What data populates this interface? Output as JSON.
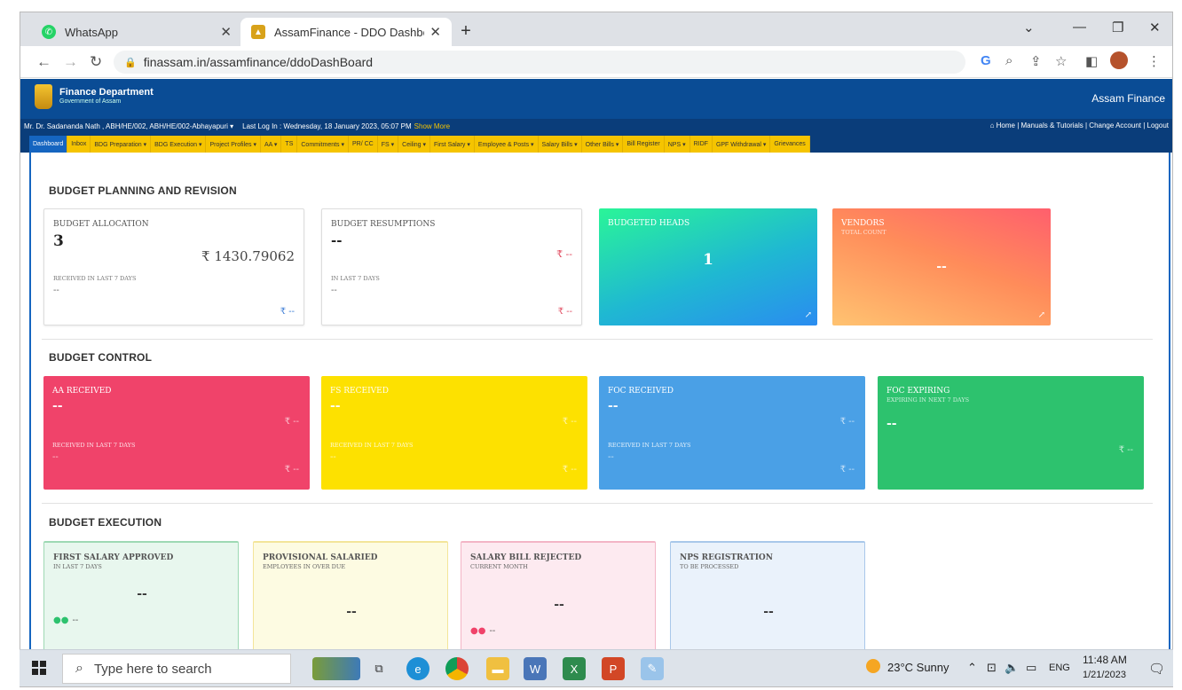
{
  "browser": {
    "tabs": [
      {
        "title": "WhatsApp",
        "active": false
      },
      {
        "title": "AssamFinance - DDO Dashboard",
        "active": true
      }
    ],
    "url": "finassam.in/assamfinance/ddoDashBoard"
  },
  "header": {
    "dept": "Finance Department",
    "govt": "Government of Assam",
    "brand": "Assam Finance",
    "user": "Mr. Dr. Sadananda Nath , ABH/HE/002, ABH/HE/002-Abhayapuri ▾",
    "last_login": "Last Log In : Wednesday, 18 January 2023, 05:07 PM",
    "show_more": "Show More",
    "links": "⌂ Home | Manuals & Tutorials | Change Account | Logout"
  },
  "menu": [
    "Dashboard",
    "Inbox",
    "BDG Preparation ▾",
    "BDG Execution ▾",
    "Project Profiles ▾",
    "AA ▾",
    "TS",
    "Commitments ▾",
    "PR/ CC",
    "FS ▾",
    "Ceiling ▾",
    "First Salary ▾",
    "Employee & Posts ▾",
    "Salary Bills ▾",
    "Other Bills ▾",
    "Bill Register",
    "NPS ▾",
    "RIDF",
    "GPF Withdrawal ▾",
    "Grievances"
  ],
  "sections": {
    "planning": "BUDGET PLANNING AND REVISION",
    "control": "BUDGET CONTROL",
    "execution": "BUDGET EXECUTION"
  },
  "planning_cards": {
    "allocation": {
      "label": "BUDGET ALLOCATION",
      "count": "3",
      "amount": "₹ 1430.79062",
      "recent_label": "RECEIVED IN LAST 7 DAYS",
      "recent_value": "--",
      "recent_amount": "₹ --"
    },
    "resumptions": {
      "label": "BUDGET RESUMPTIONS",
      "count": "--",
      "amount": "₹ --",
      "recent_label": "IN LAST 7 DAYS",
      "recent_value": "--",
      "recent_amount": "₹ --"
    },
    "heads": {
      "label": "BUDGETED HEADS",
      "value": "1"
    },
    "vendors": {
      "label": "VENDORS",
      "sub": "TOTAL COUNT",
      "value": "--"
    }
  },
  "control_cards": [
    {
      "label": "AA RECEIVED",
      "value": "--",
      "amount": "₹ --",
      "recent_label": "RECEIVED IN LAST 7 DAYS",
      "recent_value": "--",
      "recent_amount": "₹ --",
      "color": "#f0436a"
    },
    {
      "label": "FS RECEIVED",
      "value": "--",
      "amount": "₹ --",
      "recent_label": "RECEIVED IN LAST 7 DAYS",
      "recent_value": "--",
      "recent_amount": "₹ --",
      "color": "#fde100"
    },
    {
      "label": "FOC RECEIVED",
      "value": "--",
      "amount": "₹ --",
      "recent_label": "RECEIVED IN LAST 7 DAYS",
      "recent_value": "--",
      "recent_amount": "₹ --",
      "color": "#4aa0e6"
    },
    {
      "label": "FOC EXPIRING",
      "sub": "EXPIRING IN NEXT 7 DAYS",
      "value": "--",
      "amount": "₹ --",
      "color": "#2dc26e"
    }
  ],
  "execution_cards": [
    {
      "label": "FIRST SALARY APPROVED",
      "sub": "IN LAST 7 DAYS",
      "value": "--",
      "foot": "--",
      "bg": "#e8f7ee",
      "border": "#9ed9b4"
    },
    {
      "label": "PROVISIONAL SALARIED",
      "sub": "EMPLOYEES IN OVER DUE",
      "value": "--",
      "bg": "#fdfbe2",
      "border": "#f3e59a"
    },
    {
      "label": "SALARY BILL REJECTED",
      "sub": "CURRENT MONTH",
      "value": "--",
      "foot": "--",
      "bg": "#fdeaf0",
      "border": "#f3b5c6"
    },
    {
      "label": "NPS REGISTRATION",
      "sub": "TO BE PROCESSED",
      "value": "--",
      "bg": "#eaf2fb",
      "border": "#a9c8ea"
    }
  ],
  "taskbar": {
    "search_placeholder": "Type here to search",
    "weather": "23°C  Sunny",
    "lang": "ENG",
    "time": "11:48 AM",
    "date": "1/21/2023"
  }
}
